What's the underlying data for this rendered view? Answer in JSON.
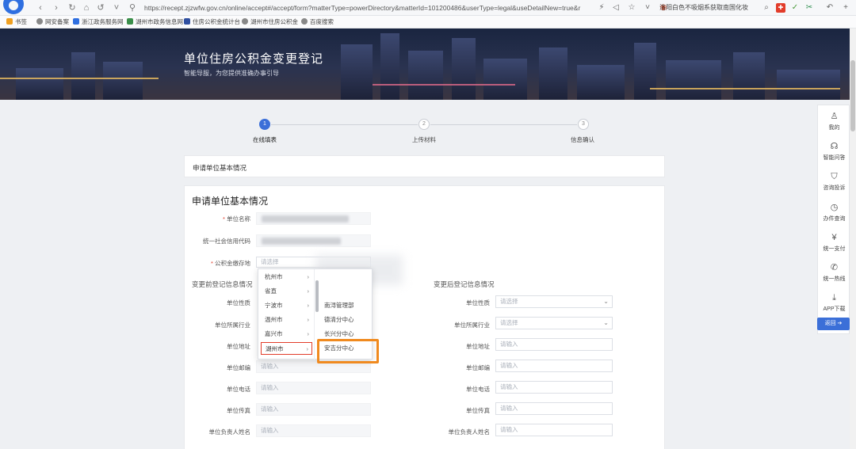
{
  "browser": {
    "url": "https://recept.zjzwfw.gov.cn/online/accept#/accept/form?matterType=powerDirectory&matterId=101200486&userType=legal&useDetailNew=true&r",
    "news_text": "洛阳白色不吸烟系获取南国化妆",
    "bookmarks": [
      "书签",
      "网安备案",
      "浙江政务服务网",
      "湖州市政务信息网",
      "住房公积金统计台",
      "湖州市住房公积金",
      "百度搜索"
    ]
  },
  "banner": {
    "title": "单位住房公积金变更登记",
    "subtitle": "智能导服，为您提供准确办事引导"
  },
  "steps": [
    {
      "num": "1",
      "label": "在线填表",
      "state": "active"
    },
    {
      "num": "2",
      "label": "上传材料",
      "state": "idle"
    },
    {
      "num": "3",
      "label": "信息确认",
      "state": "idle"
    }
  ],
  "section_strip": "申请单位基本情况",
  "form": {
    "title": "申请单位基本情况",
    "unit_name_label": "单位名称",
    "credit_code_label": "统一社会信用代码",
    "deposit_location_label": "公积金缴存地",
    "deposit_location_placeholder": "请选择",
    "before_heading": "变更前登记信息情况",
    "after_heading": "变更后登记信息情况",
    "left_fields": [
      {
        "label": "单位性质",
        "placeholder": ""
      },
      {
        "label": "单位所属行业",
        "placeholder": ""
      },
      {
        "label": "单位地址",
        "placeholder": ""
      },
      {
        "label": "单位邮编",
        "placeholder": "请输入"
      },
      {
        "label": "单位电话",
        "placeholder": "请输入"
      },
      {
        "label": "单位传真",
        "placeholder": "请输入"
      },
      {
        "label": "单位负责人姓名",
        "placeholder": "请输入"
      }
    ],
    "right_fields": [
      {
        "label": "单位性质",
        "placeholder": "请选择"
      },
      {
        "label": "单位所属行业",
        "placeholder": "请选择"
      },
      {
        "label": "单位地址",
        "placeholder": "请输入"
      },
      {
        "label": "单位邮编",
        "placeholder": "请输入"
      },
      {
        "label": "单位电话",
        "placeholder": "请输入"
      },
      {
        "label": "单位传真",
        "placeholder": "请输入"
      },
      {
        "label": "单位负责人姓名",
        "placeholder": "请输入"
      }
    ]
  },
  "dropdown": {
    "cities": [
      "杭州市",
      "省直",
      "宁波市",
      "温州市",
      "嘉兴市",
      "湖州市"
    ],
    "selected_city": "湖州市",
    "centers": [
      "南浔管理部",
      "德清分中心",
      "长兴分中心",
      "安吉分中心"
    ],
    "highlighted_center": "安吉分中心"
  },
  "sidebar": {
    "items": [
      "我的",
      "智能问答",
      "咨询投诉",
      "办件查询",
      "统一支付",
      "统一热线",
      "APP下载"
    ],
    "back_label": "返回"
  },
  "colors": {
    "accent": "#3b6fd8",
    "highlight": "#f08a1f",
    "required": "#e23c2a"
  }
}
